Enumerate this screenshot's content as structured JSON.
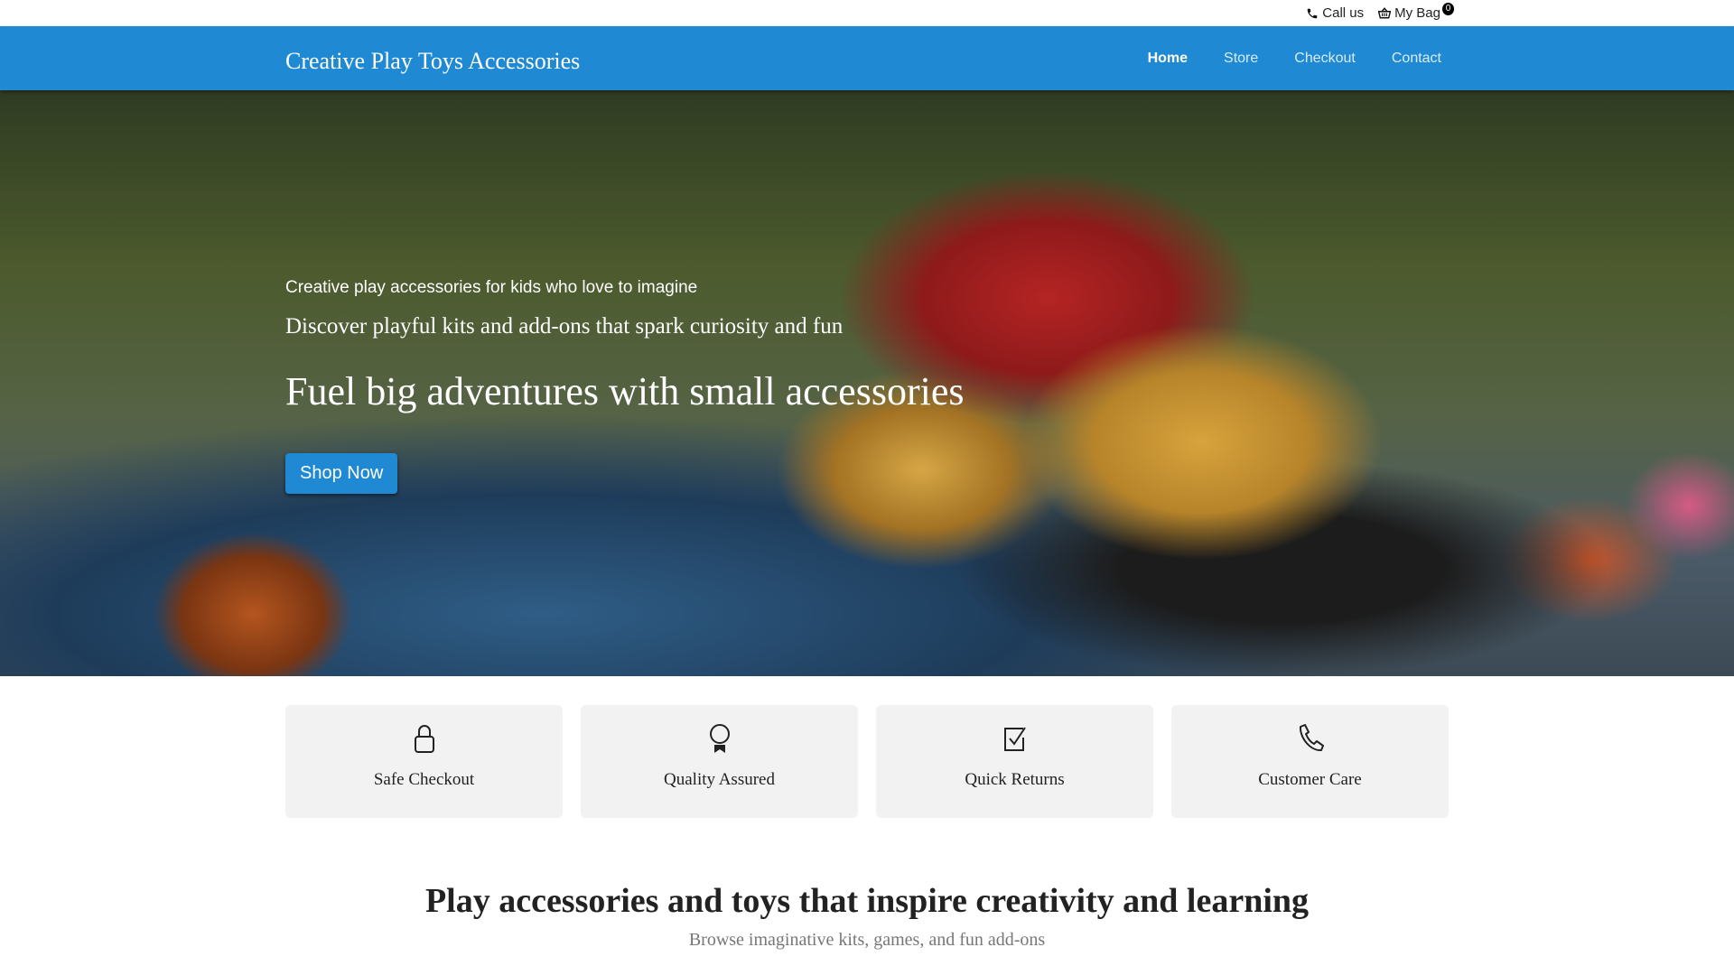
{
  "topbar": {
    "call": "Call us",
    "bag": "My Bag",
    "bag_count": "0"
  },
  "nav": {
    "brand": "Creative Play Toys Accessories",
    "links": [
      "Home",
      "Store",
      "Checkout",
      "Contact"
    ]
  },
  "hero": {
    "tagline": "Creative play accessories for kids who love to imagine",
    "subtitle": "Discover playful kits and add-ons that spark curiosity and fun",
    "headline": "Fuel big adventures with small accessories",
    "cta": "Shop Now"
  },
  "features": [
    {
      "icon": "lock-icon",
      "label": "Safe Checkout"
    },
    {
      "icon": "award-icon",
      "label": "Quality Assured"
    },
    {
      "icon": "check-square-icon",
      "label": "Quick Returns"
    },
    {
      "icon": "phone-icon",
      "label": "Customer Care"
    }
  ],
  "section": {
    "title": "Play accessories and toys that inspire creativity and learning",
    "subtitle": "Browse imaginative kits, games, and fun add-ons"
  }
}
